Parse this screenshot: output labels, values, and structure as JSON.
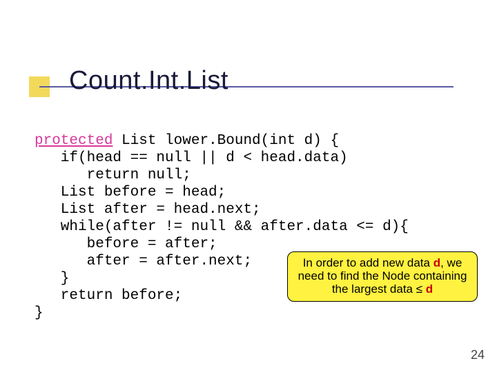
{
  "slide": {
    "title": "Count.Int.List",
    "page_number": "24"
  },
  "code": {
    "keyword": "protected",
    "lines": [
      " List lower.Bound(int d) {",
      "   if(head == null || d < head.data)",
      "      return null;",
      "   List before = head;",
      "   List after = head.next;",
      "   while(after != null && after.data <= d){",
      "      before = after;",
      "      after = after.next;",
      "   }",
      "   return before;",
      "}"
    ]
  },
  "callout": {
    "prefix": "In order to add new data ",
    "var": "d",
    "mid": ", we need to find the Node containing the largest data ≤ ",
    "var2": "d"
  }
}
